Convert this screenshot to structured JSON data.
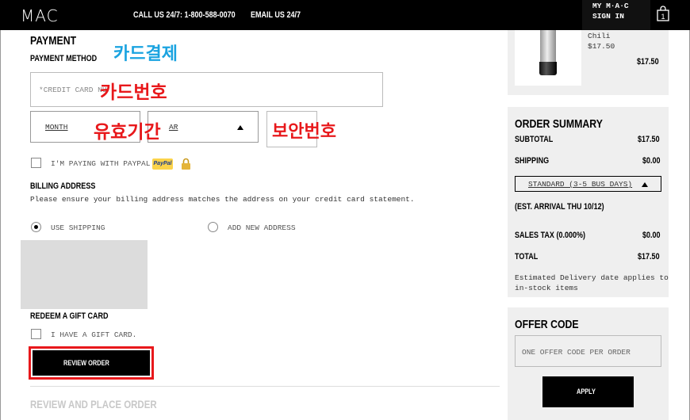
{
  "header": {
    "logo": "MAC",
    "call": "CALL US 24/7: 1-800-588-0070",
    "email": "EMAIL US 24/7",
    "my_mac": "MY M·A·C",
    "sign_in": "SIGN IN",
    "bag_count": "1"
  },
  "payment": {
    "title": "PAYMENT",
    "method_label": "PAYMENT METHOD",
    "card_placeholder": "*CREDIT CARD NU",
    "month_label": "MONTH",
    "year_label": "AR",
    "paypal_label": "I'M PAYING WITH PAYPAL",
    "paypal_logo": "PayPal"
  },
  "annotations": {
    "card_payment": "카드결제",
    "card_number": "카드번호",
    "expiry": "유효기간",
    "security_code": "보안번호"
  },
  "billing": {
    "title": "BILLING ADDRESS",
    "note": "Please ensure your billing address matches the address on your credit card statement.",
    "use_shipping": "USE SHIPPING",
    "add_new": "ADD NEW ADDRESS"
  },
  "gift": {
    "title": "REDEEM A GIFT CARD",
    "label": "I HAVE A GIFT CARD."
  },
  "actions": {
    "review_order": "REVIEW ORDER",
    "review_place_title": "REVIEW AND PLACE ORDER"
  },
  "cart": {
    "product_name": "Chili",
    "product_price": "$17.50",
    "line_total": "$17.50"
  },
  "summary": {
    "title": "ORDER SUMMARY",
    "subtotal_label": "SUBTOTAL",
    "subtotal_value": "$17.50",
    "shipping_label": "SHIPPING",
    "shipping_value": "$0.00",
    "shipping_option": "STANDARD (3-5 BUS DAYS)",
    "est_arrival": "(EST. ARRIVAL THU 10/12)",
    "tax_label": "SALES TAX (0.000%)",
    "tax_value": "$0.00",
    "total_label": "TOTAL",
    "total_value": "$17.50",
    "delivery_note_1": "Estimated Delivery date applies to",
    "delivery_note_2": "in-stock items"
  },
  "offer": {
    "title": "OFFER CODE",
    "placeholder": "ONE OFFER CODE PER ORDER",
    "apply": "APPLY"
  },
  "colors": {
    "annotation_red": "#e8181b",
    "annotation_blue": "#1aa3e0",
    "panel_gray": "#efefef",
    "black": "#000000"
  }
}
